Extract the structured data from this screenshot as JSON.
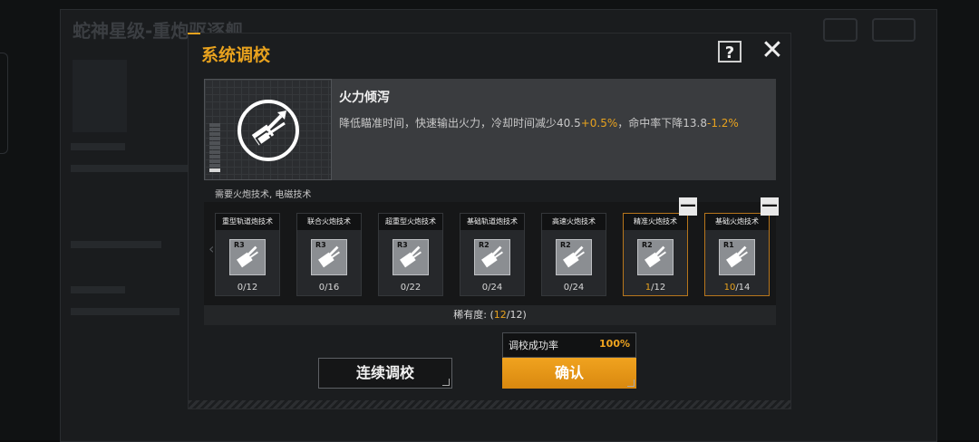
{
  "background": {
    "title": "蛇神星级-重炮驱逐舰"
  },
  "dialog": {
    "title": "系统调校",
    "help_label": "?",
    "close_label": "✕"
  },
  "skill": {
    "name": "火力倾泻",
    "icon": "fire-burst-icon",
    "level_filled": 1,
    "level_total": 11,
    "desc_prefix": "降低瞄准时间，快速输出火力，冷却时间减少40.5",
    "desc_bonus1": "+0.5%",
    "desc_mid": "，命中率下降13.8",
    "desc_bonus2": "-1.2%"
  },
  "requirement": "需要火炮技术, 电磁技术",
  "techs": [
    {
      "name": "重型轨道炮技术",
      "rank": "R3",
      "count": "0/12",
      "selected": false,
      "count_highlight": "",
      "count_rest": "0/12"
    },
    {
      "name": "联合火炮技术",
      "rank": "R3",
      "count": "0/16",
      "selected": false,
      "count_highlight": "",
      "count_rest": "0/16"
    },
    {
      "name": "超重型火炮技术",
      "rank": "R3",
      "count": "0/22",
      "selected": false,
      "count_highlight": "",
      "count_rest": "0/22"
    },
    {
      "name": "基础轨道炮技术",
      "rank": "R2",
      "count": "0/24",
      "selected": false,
      "count_highlight": "",
      "count_rest": "0/24"
    },
    {
      "name": "高速火炮技术",
      "rank": "R2",
      "count": "0/24",
      "selected": false,
      "count_highlight": "",
      "count_rest": "0/24"
    },
    {
      "name": "精准火炮技术",
      "rank": "R2",
      "count": "1/12",
      "selected": true,
      "count_highlight": "1",
      "count_rest": "/12"
    },
    {
      "name": "基础火炮技术",
      "rank": "R1",
      "count": "10/14",
      "selected": true,
      "count_highlight": "10",
      "count_rest": "/14"
    }
  ],
  "minus_label": "—",
  "rarity": {
    "prefix": "稀有度: (",
    "value": "12",
    "suffix": "/12)"
  },
  "success_rate": {
    "label": "调校成功率",
    "value": "100%"
  },
  "buttons": {
    "continue": "连续调校",
    "confirm": "确认"
  },
  "colors": {
    "accent": "#e8a21e",
    "panel": "#1b1d1f"
  }
}
